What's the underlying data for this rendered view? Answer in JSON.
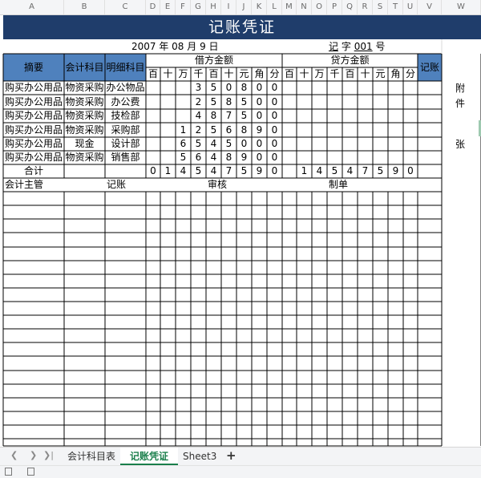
{
  "columns": [
    "A",
    "B",
    "C",
    "D",
    "E",
    "F",
    "G",
    "H",
    "I",
    "J",
    "K",
    "L",
    "M",
    "N",
    "O",
    "P",
    "Q",
    "R",
    "S",
    "T",
    "U",
    "V",
    "W"
  ],
  "title": "记账凭证",
  "date_text": "2007 年 08 月 9 日",
  "voucher": {
    "prefix": "记",
    "word": "字",
    "number": "001",
    "suffix": "号"
  },
  "headers": {
    "summary": "摘要",
    "account": "会计科目",
    "detail": "明细科目",
    "debit": "借方金额",
    "credit": "贷方金额",
    "posted": "记账",
    "units": [
      "百",
      "十",
      "万",
      "千",
      "百",
      "十",
      "元",
      "角",
      "分"
    ]
  },
  "rows": [
    {
      "summary": "购买办公用品",
      "account": "物资采购",
      "detail": "办公物品",
      "debit": [
        "",
        "",
        "",
        "3",
        "5",
        "0",
        "8",
        "0",
        "0"
      ]
    },
    {
      "summary": "购买办公用品",
      "account": "物资采购",
      "detail": "办公费",
      "debit": [
        "",
        "",
        "",
        "2",
        "5",
        "8",
        "5",
        "0",
        "0"
      ]
    },
    {
      "summary": "购买办公用品",
      "account": "物资采购",
      "detail": "技检部",
      "debit": [
        "",
        "",
        "",
        "4",
        "8",
        "7",
        "5",
        "0",
        "0"
      ]
    },
    {
      "summary": "购买办公用品",
      "account": "物资采购",
      "detail": "采购部",
      "debit": [
        "",
        "",
        "1",
        "2",
        "5",
        "6",
        "8",
        "9",
        "0"
      ]
    },
    {
      "summary": "购买办公用品",
      "account": "现金",
      "detail": "设计部",
      "debit": [
        "",
        "",
        "6",
        "5",
        "4",
        "5",
        "0",
        "0",
        "0"
      ]
    },
    {
      "summary": "购买办公用品",
      "account": "物资采购",
      "detail": "销售部",
      "debit": [
        "",
        "",
        "5",
        "6",
        "4",
        "8",
        "9",
        "0",
        "0"
      ]
    }
  ],
  "total": {
    "label": "合计",
    "debit": [
      "0",
      "1",
      "4",
      "5",
      "4",
      "7",
      "5",
      "9",
      "0"
    ],
    "credit": [
      "",
      "1",
      "4",
      "5",
      "4",
      "7",
      "5",
      "9",
      "0"
    ]
  },
  "attachment": {
    "a": "附",
    "b": "件",
    "c": "张"
  },
  "signatures": [
    "会计主管",
    "记账",
    "审核",
    "制单"
  ],
  "tabs": [
    "会计科目表",
    "记账凭证",
    "Sheet3"
  ],
  "active_tab": "记账凭证",
  "colors": {
    "title_bg": "#1f3d6b",
    "header_bg": "#4f81bd",
    "active_tab": "#1a7f4b"
  }
}
